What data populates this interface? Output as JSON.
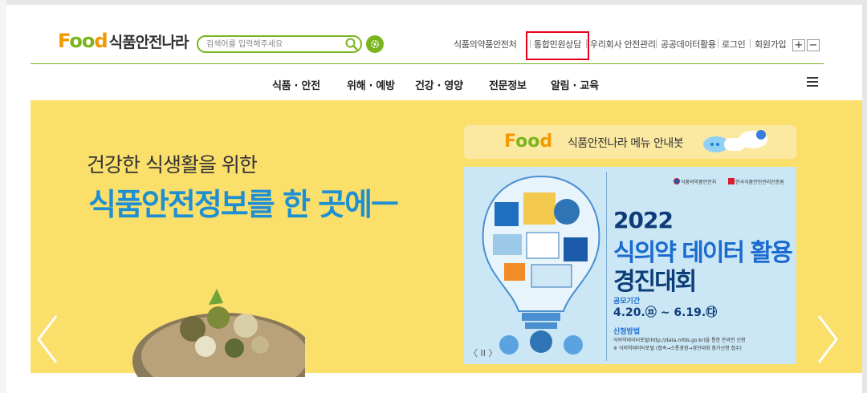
{
  "header": {
    "logo_word": "Food",
    "logo_text": "식품안전나라",
    "search": {
      "placeholder": "검색어를 입력해주세요"
    },
    "util_links": [
      "식품의약품안전처",
      "통합민원상담",
      "우리회사 안전관리",
      "공공데이터활용",
      "로그인",
      "회원가입"
    ],
    "font_plus": "+",
    "font_minus": "−"
  },
  "nav": {
    "items": [
      "식품 · 안전",
      "위해 · 예방",
      "건강 · 영양",
      "전문정보",
      "알림 · 교육"
    ]
  },
  "hero": {
    "subtitle": "건강한 식생활을 위한",
    "title": "식품안전정보를 한 곳에ㅡ"
  },
  "guide": {
    "food_word": "Food",
    "text": "식품안전나라 메뉴 안내봇"
  },
  "banner": {
    "org1": "식품의약품안전처",
    "org2": "한국식품안전관리인증원",
    "year": "2022",
    "title1": "식의약 데이터 활용",
    "title2": "경진대회",
    "period_label": "공모기간",
    "period": "4.20.㉬ ~ 6.19.㉰",
    "method_label": "신청방법",
    "method1": "식의약데이터포털(http://data.mfds.go.kr)을 통한 온라인 신청",
    "method2": "※ 식의약데이터포털 (접속→소통광장→경진대회 참가신청 접수)",
    "pager": "〈 II 〉"
  },
  "colors": {
    "brand_green": "#7ab51d",
    "brand_orange": "#f39800",
    "hero_bg": "#fadf6b",
    "title_blue": "#1f8fd3",
    "highlight_red": "#e8001c"
  }
}
